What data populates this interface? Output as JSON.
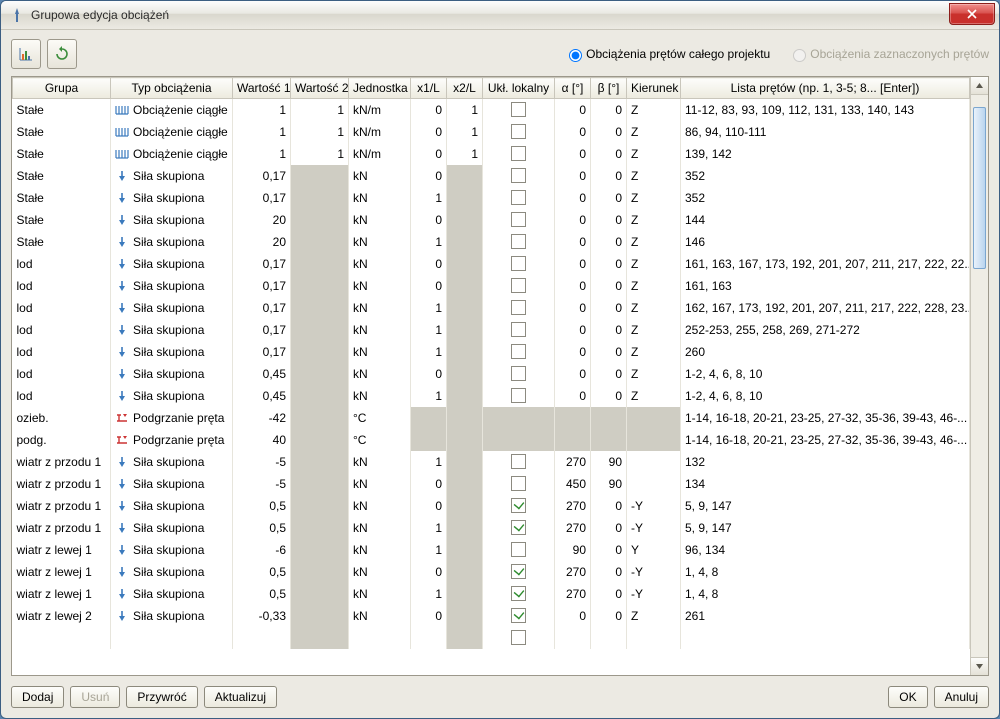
{
  "window": {
    "title": "Grupowa edycja obciążeń"
  },
  "toolbar": {
    "chart_btn_name": "chart-button",
    "refresh_btn_name": "refresh-button",
    "radio_all": "Obciążenia prętów całego projektu",
    "radio_sel": "Obciążenia zaznaczonych prętów"
  },
  "headers": {
    "grupa": "Grupa",
    "typ": "Typ obciążenia",
    "w1": "Wartość 1",
    "w2": "Wartość 2",
    "unit": "Jednostka",
    "x1": "x1/L",
    "x2": "x2/L",
    "ukl": "Ukł. lokalny",
    "a": "α [°]",
    "b": "β [°]",
    "kier": "Kierunek",
    "lista": "Lista prętów (np. 1, 3-5; 8... [Enter])"
  },
  "rows": [
    {
      "grupa": "Stałe",
      "ico": "dist",
      "typ": "Obciążenie ciągłe",
      "w1": "1",
      "w2": "1",
      "unit": "kN/m",
      "x1": "0",
      "x2": "1",
      "ukl": false,
      "a": "0",
      "b": "0",
      "kier": "Z",
      "lista": "11-12, 83, 93, 109, 112, 131, 133, 140, 143"
    },
    {
      "grupa": "Stałe",
      "ico": "dist",
      "typ": "Obciążenie ciągłe",
      "w1": "1",
      "w2": "1",
      "unit": "kN/m",
      "x1": "0",
      "x2": "1",
      "ukl": false,
      "a": "0",
      "b": "0",
      "kier": "Z",
      "lista": "86, 94, 110-111"
    },
    {
      "grupa": "Stałe",
      "ico": "dist",
      "typ": "Obciążenie ciągłe",
      "w1": "1",
      "w2": "1",
      "unit": "kN/m",
      "x1": "0",
      "x2": "1",
      "ukl": false,
      "a": "0",
      "b": "0",
      "kier": "Z",
      "lista": "139, 142"
    },
    {
      "grupa": "Stałe",
      "ico": "point",
      "typ": "Siła skupiona",
      "w1": "0,17",
      "w2": "",
      "unit": "kN",
      "x1": "0",
      "x2": "",
      "ukl": false,
      "a": "0",
      "b": "0",
      "kier": "Z",
      "lista": "352"
    },
    {
      "grupa": "Stałe",
      "ico": "point",
      "typ": "Siła skupiona",
      "w1": "0,17",
      "w2": "",
      "unit": "kN",
      "x1": "1",
      "x2": "",
      "ukl": false,
      "a": "0",
      "b": "0",
      "kier": "Z",
      "lista": "352"
    },
    {
      "grupa": "Stałe",
      "ico": "point",
      "typ": "Siła skupiona",
      "w1": "20",
      "w2": "",
      "unit": "kN",
      "x1": "0",
      "x2": "",
      "ukl": false,
      "a": "0",
      "b": "0",
      "kier": "Z",
      "lista": "144"
    },
    {
      "grupa": "Stałe",
      "ico": "point",
      "typ": "Siła skupiona",
      "w1": "20",
      "w2": "",
      "unit": "kN",
      "x1": "1",
      "x2": "",
      "ukl": false,
      "a": "0",
      "b": "0",
      "kier": "Z",
      "lista": "146"
    },
    {
      "grupa": "lod",
      "ico": "point",
      "typ": "Siła skupiona",
      "w1": "0,17",
      "w2": "",
      "unit": "kN",
      "x1": "0",
      "x2": "",
      "ukl": false,
      "a": "0",
      "b": "0",
      "kier": "Z",
      "lista": "161, 163, 167, 173, 192, 201, 207, 211, 217, 222, 22..."
    },
    {
      "grupa": "lod",
      "ico": "point",
      "typ": "Siła skupiona",
      "w1": "0,17",
      "w2": "",
      "unit": "kN",
      "x1": "0",
      "x2": "",
      "ukl": false,
      "a": "0",
      "b": "0",
      "kier": "Z",
      "lista": "161, 163"
    },
    {
      "grupa": "lod",
      "ico": "point",
      "typ": "Siła skupiona",
      "w1": "0,17",
      "w2": "",
      "unit": "kN",
      "x1": "1",
      "x2": "",
      "ukl": false,
      "a": "0",
      "b": "0",
      "kier": "Z",
      "lista": "162, 167, 173, 192, 201, 207, 211, 217, 222, 228, 23..."
    },
    {
      "grupa": "lod",
      "ico": "point",
      "typ": "Siła skupiona",
      "w1": "0,17",
      "w2": "",
      "unit": "kN",
      "x1": "1",
      "x2": "",
      "ukl": false,
      "a": "0",
      "b": "0",
      "kier": "Z",
      "lista": "252-253, 255, 258, 269, 271-272"
    },
    {
      "grupa": "lod",
      "ico": "point",
      "typ": "Siła skupiona",
      "w1": "0,17",
      "w2": "",
      "unit": "kN",
      "x1": "1",
      "x2": "",
      "ukl": false,
      "a": "0",
      "b": "0",
      "kier": "Z",
      "lista": "260"
    },
    {
      "grupa": "lod",
      "ico": "point",
      "typ": "Siła skupiona",
      "w1": "0,45",
      "w2": "",
      "unit": "kN",
      "x1": "0",
      "x2": "",
      "ukl": false,
      "a": "0",
      "b": "0",
      "kier": "Z",
      "lista": "1-2, 4, 6, 8, 10"
    },
    {
      "grupa": "lod",
      "ico": "point",
      "typ": "Siła skupiona",
      "w1": "0,45",
      "w2": "",
      "unit": "kN",
      "x1": "1",
      "x2": "",
      "ukl": false,
      "a": "0",
      "b": "0",
      "kier": "Z",
      "lista": "1-2, 4, 6, 8, 10"
    },
    {
      "grupa": "ozieb.",
      "ico": "temp",
      "typ": "Podgrzanie pręta",
      "w1": "-42",
      "w2": "",
      "unit": "°C",
      "x1": "",
      "x2": "",
      "ukl": "na",
      "a": "",
      "b": "",
      "kier": "",
      "lista": "1-14, 16-18, 20-21, 23-25, 27-32, 35-36, 39-43, 46-..."
    },
    {
      "grupa": "podg.",
      "ico": "temp",
      "typ": "Podgrzanie pręta",
      "w1": "40",
      "w2": "",
      "unit": "°C",
      "x1": "",
      "x2": "",
      "ukl": "na",
      "a": "",
      "b": "",
      "kier": "",
      "lista": "1-14, 16-18, 20-21, 23-25, 27-32, 35-36, 39-43, 46-..."
    },
    {
      "grupa": "wiatr z przodu 1",
      "ico": "point",
      "typ": "Siła skupiona",
      "w1": "-5",
      "w2": "",
      "unit": "kN",
      "x1": "1",
      "x2": "",
      "ukl": false,
      "a": "270",
      "b": "90",
      "kier": "",
      "lista": "132"
    },
    {
      "grupa": "wiatr z przodu 1",
      "ico": "point",
      "typ": "Siła skupiona",
      "w1": "-5",
      "w2": "",
      "unit": "kN",
      "x1": "0",
      "x2": "",
      "ukl": false,
      "a": "450",
      "b": "90",
      "kier": "",
      "lista": "134"
    },
    {
      "grupa": "wiatr z przodu 1",
      "ico": "point",
      "typ": "Siła skupiona",
      "w1": "0,5",
      "w2": "",
      "unit": "kN",
      "x1": "0",
      "x2": "",
      "ukl": true,
      "a": "270",
      "b": "0",
      "kier": "-Y",
      "lista": "5, 9, 147"
    },
    {
      "grupa": "wiatr z przodu 1",
      "ico": "point",
      "typ": "Siła skupiona",
      "w1": "0,5",
      "w2": "",
      "unit": "kN",
      "x1": "1",
      "x2": "",
      "ukl": true,
      "a": "270",
      "b": "0",
      "kier": "-Y",
      "lista": "5, 9, 147"
    },
    {
      "grupa": "wiatr z lewej 1",
      "ico": "point",
      "typ": "Siła skupiona",
      "w1": "-6",
      "w2": "",
      "unit": "kN",
      "x1": "1",
      "x2": "",
      "ukl": false,
      "a": "90",
      "b": "0",
      "kier": "Y",
      "lista": "96, 134"
    },
    {
      "grupa": "wiatr z lewej 1",
      "ico": "point",
      "typ": "Siła skupiona",
      "w1": "0,5",
      "w2": "",
      "unit": "kN",
      "x1": "0",
      "x2": "",
      "ukl": true,
      "a": "270",
      "b": "0",
      "kier": "-Y",
      "lista": "1, 4, 8"
    },
    {
      "grupa": "wiatr z lewej 1",
      "ico": "point",
      "typ": "Siła skupiona",
      "w1": "0,5",
      "w2": "",
      "unit": "kN",
      "x1": "1",
      "x2": "",
      "ukl": true,
      "a": "270",
      "b": "0",
      "kier": "-Y",
      "lista": "1, 4, 8"
    },
    {
      "grupa": "wiatr z lewej 2",
      "ico": "point",
      "typ": "Siła skupiona",
      "w1": "-0,33",
      "w2": "",
      "unit": "kN",
      "x1": "0",
      "x2": "",
      "ukl": true,
      "a": "0",
      "b": "0",
      "kier": "Z",
      "lista": "261"
    }
  ],
  "buttons": {
    "dodaj": "Dodaj",
    "usun": "Usuń",
    "przywroc": "Przywróć",
    "aktualizuj": "Aktualizuj",
    "ok": "OK",
    "anuluj": "Anuluj"
  }
}
